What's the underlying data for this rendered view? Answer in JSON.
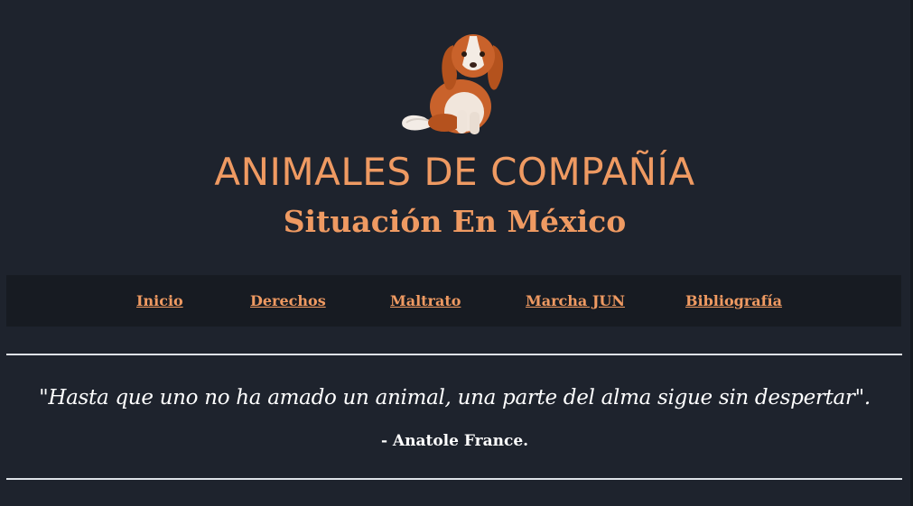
{
  "header": {
    "logo_icon": "cavalier-dog-icon",
    "title": "ANIMALES DE COMPAÑÍA",
    "subtitle": "Situación En México"
  },
  "nav": {
    "items": [
      {
        "label": "Inicio"
      },
      {
        "label": "Derechos"
      },
      {
        "label": "Maltrato"
      },
      {
        "label": "Marcha JUN"
      },
      {
        "label": "Bibliografía"
      }
    ]
  },
  "quote": {
    "text": "\"Hasta que uno no ha amado un animal, una parte del alma sigue sin despertar\".",
    "author": "- Anatole France."
  },
  "colors": {
    "background": "#1e232d",
    "navbar": "#171b22",
    "accent": "#ef9a62",
    "text": "#ffffff"
  }
}
